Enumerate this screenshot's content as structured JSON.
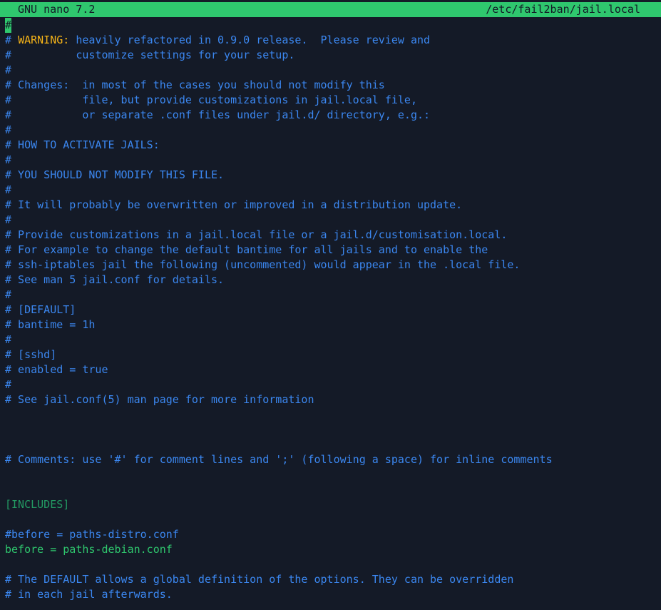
{
  "titlebar": {
    "app": "GNU nano 7.2",
    "file_path": "/etc/fail2ban/jail.local"
  },
  "colors": {
    "background": "#141a27",
    "titlebar": "#2fc76e",
    "comment": "#3b87f0",
    "warning": "#f5b318",
    "section": "#239a63",
    "code": "#2fc76e"
  },
  "editor": {
    "lines": [
      {
        "kind": "cursor",
        "text": "#"
      },
      {
        "kind": "warning",
        "prefix": "# ",
        "keyword": "WARNING:",
        "rest": " heavily refactored in 0.9.0 release.  Please review and"
      },
      {
        "kind": "comment",
        "text": "#          customize settings for your setup."
      },
      {
        "kind": "comment",
        "text": "#"
      },
      {
        "kind": "comment",
        "text": "# Changes:  in most of the cases you should not modify this"
      },
      {
        "kind": "comment",
        "text": "#           file, but provide customizations in jail.local file,"
      },
      {
        "kind": "comment",
        "text": "#           or separate .conf files under jail.d/ directory, e.g.:"
      },
      {
        "kind": "comment",
        "text": "#"
      },
      {
        "kind": "comment",
        "text": "# HOW TO ACTIVATE JAILS:"
      },
      {
        "kind": "comment",
        "text": "#"
      },
      {
        "kind": "comment",
        "text": "# YOU SHOULD NOT MODIFY THIS FILE."
      },
      {
        "kind": "comment",
        "text": "#"
      },
      {
        "kind": "comment",
        "text": "# It will probably be overwritten or improved in a distribution update."
      },
      {
        "kind": "comment",
        "text": "#"
      },
      {
        "kind": "comment",
        "text": "# Provide customizations in a jail.local file or a jail.d/customisation.local."
      },
      {
        "kind": "comment",
        "text": "# For example to change the default bantime for all jails and to enable the"
      },
      {
        "kind": "comment",
        "text": "# ssh-iptables jail the following (uncommented) would appear in the .local file."
      },
      {
        "kind": "comment",
        "text": "# See man 5 jail.conf for details."
      },
      {
        "kind": "comment",
        "text": "#"
      },
      {
        "kind": "comment",
        "text": "# [DEFAULT]"
      },
      {
        "kind": "comment",
        "text": "# bantime = 1h"
      },
      {
        "kind": "comment",
        "text": "#"
      },
      {
        "kind": "comment",
        "text": "# [sshd]"
      },
      {
        "kind": "comment",
        "text": "# enabled = true"
      },
      {
        "kind": "comment",
        "text": "#"
      },
      {
        "kind": "comment",
        "text": "# See jail.conf(5) man page for more information"
      },
      {
        "kind": "blank",
        "text": ""
      },
      {
        "kind": "blank",
        "text": ""
      },
      {
        "kind": "blank",
        "text": ""
      },
      {
        "kind": "comment",
        "text": "# Comments: use '#' for comment lines and ';' (following a space) for inline comments"
      },
      {
        "kind": "blank",
        "text": ""
      },
      {
        "kind": "blank",
        "text": ""
      },
      {
        "kind": "section",
        "text": "[INCLUDES]"
      },
      {
        "kind": "blank",
        "text": ""
      },
      {
        "kind": "comment",
        "text": "#before = paths-distro.conf"
      },
      {
        "kind": "code",
        "text": "before = paths-debian.conf"
      },
      {
        "kind": "blank",
        "text": ""
      },
      {
        "kind": "comment",
        "text": "# The DEFAULT allows a global definition of the options. They can be overridden"
      },
      {
        "kind": "comment",
        "text": "# in each jail afterwards."
      }
    ]
  }
}
